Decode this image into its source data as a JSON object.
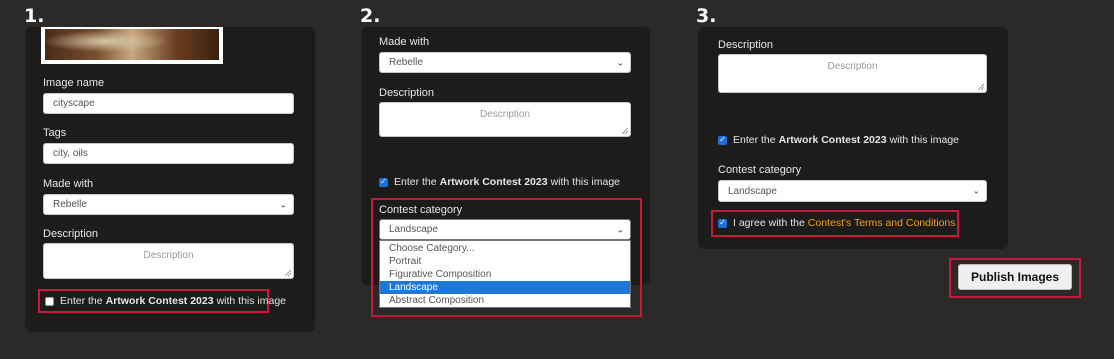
{
  "steps": [
    "1.",
    "2.",
    "3."
  ],
  "panel1": {
    "image_name_label": "Image name",
    "image_name_value": "cityscape",
    "tags_label": "Tags",
    "tags_value": "city, oils",
    "made_with_label": "Made with",
    "made_with_value": "Rebelle",
    "description_label": "Description",
    "description_placeholder": "Description",
    "contest_prefix": "Enter the",
    "contest_name": "Artwork Contest 2023",
    "contest_suffix": "with this image",
    "contest_checked": false
  },
  "panel2": {
    "made_with_label": "Made with",
    "made_with_value": "Rebelle",
    "description_label": "Description",
    "description_placeholder": "Description",
    "contest_prefix": "Enter the",
    "contest_name": "Artwork Contest 2023",
    "contest_suffix": "with this image",
    "contest_checked": true,
    "category_label": "Contest category",
    "category_value": "Landscape",
    "category_options": [
      "Choose Category...",
      "Portrait",
      "Figurative Composition",
      "Landscape",
      "Abstract Composition"
    ],
    "category_selected": "Landscape"
  },
  "panel3": {
    "description_label": "Description",
    "description_placeholder": "Description",
    "contest_prefix": "Enter the",
    "contest_name": "Artwork Contest 2023",
    "contest_suffix": "with this image",
    "contest_checked": true,
    "category_label": "Contest category",
    "category_value": "Landscape",
    "terms_prefix": "I agree with the",
    "terms_link": "Contest's Terms and Conditions",
    "terms_checked": true,
    "publish_label": "Publish Images"
  },
  "colors": {
    "background": "#2b2a28",
    "panel": "#1d1c1b",
    "highlight": "#c8193c",
    "link": "#f0a020",
    "selected": "#1e78d6"
  }
}
